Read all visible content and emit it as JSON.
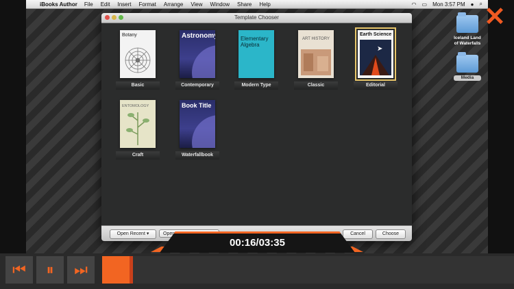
{
  "menubar": {
    "app": "iBooks Author",
    "items": [
      "File",
      "Edit",
      "Insert",
      "Format",
      "Arrange",
      "View",
      "Window",
      "Share",
      "Help"
    ],
    "clock": "Mon 3:57 PM"
  },
  "window": {
    "title": "Template Chooser",
    "templates": [
      {
        "label": "Basic",
        "cover_text": "Botany"
      },
      {
        "label": "Contemporary",
        "cover_text": "Astronomy"
      },
      {
        "label": "Modern Type",
        "cover_text": "Elementary Algebra"
      },
      {
        "label": "Classic",
        "cover_text": "ART HISTORY"
      },
      {
        "label": "Editorial",
        "cover_text": "Earth Science"
      },
      {
        "label": "Craft",
        "cover_text": "ENTOMOLOGY"
      },
      {
        "label": "Waterfallbook",
        "cover_text": "Book Title"
      }
    ],
    "buttons": {
      "open_recent": "Open Recent",
      "open": "Open",
      "cancel": "Cancel",
      "choose": "Choose"
    }
  },
  "desktop": {
    "folder1": "Iceland Land of Waterfalls",
    "folder2": "Media"
  },
  "player": {
    "timecode": "00:16/03:35",
    "progress": 0.074
  }
}
